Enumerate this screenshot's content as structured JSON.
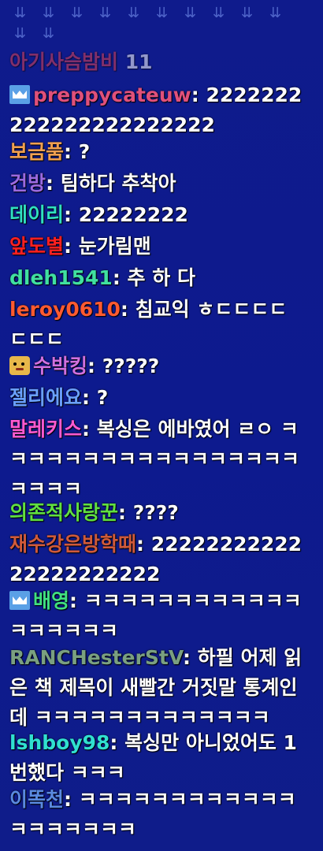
{
  "colors": {
    "background": "#0e1a8a",
    "text": "#ffffff"
  },
  "messages": [
    {
      "user": "아기사슴밤비",
      "text": "11",
      "color": "#e04050",
      "badge": "",
      "faded": true
    },
    {
      "user": "preppycateuw",
      "text": "2222222222222222222222",
      "color": "#e0507a",
      "badge": "crown-icon"
    },
    {
      "user": "보금품",
      "text": "?",
      "color": "#f0a050",
      "badge": ""
    },
    {
      "user": "건방",
      "text": "팀하다 추착아",
      "color": "#9b6ae0",
      "badge": ""
    },
    {
      "user": "데이리",
      "text": "22222222",
      "color": "#30e0c0",
      "badge": ""
    },
    {
      "user": "앞도별",
      "text": "눈가림맨",
      "color": "#ff2020",
      "badge": ""
    },
    {
      "user": "dleh1541",
      "text": "추 하 다",
      "color": "#40e0a0",
      "badge": ""
    },
    {
      "user": "leroy0610",
      "text": "침교익 ㅎㄷㄷㄷㄷ ㄷㄷㄷ",
      "color": "#ff5a30",
      "badge": ""
    },
    {
      "user": "수박킹",
      "text": "?????",
      "color": "#d070e0",
      "badge": "face-icon"
    },
    {
      "user": "젤리에요",
      "text": "?",
      "color": "#6aa0ff",
      "badge": ""
    },
    {
      "user": "말레키스",
      "text": "복싱은 에바였어 ㄹㅇ ㅋㅋㅋㅋㅋㅋㅋㅋㅋㅋㅋㅋㅋㅋㅋㅋㅋㅋㅋㅋㅋ",
      "color": "#ff5ad0",
      "badge": ""
    },
    {
      "user": "의존적사랑꾼",
      "text": "????",
      "color": "#60e040",
      "badge": ""
    },
    {
      "user": "재수강은방학때",
      "text": "2222222222222222222222",
      "color": "#d05a3a",
      "badge": ""
    },
    {
      "user": "배영",
      "text": "ㅋㅋㅋㅋㅋㅋㅋㅋㅋㅋㅋㅋㅋㅋㅋㅋㅋㅋ",
      "color": "#40e080",
      "badge": "crown-icon"
    },
    {
      "user": "RANCHesterStV",
      "text": "하필 어제 읽은 책 제목이 새빨간 거짓말 통계인데 ㅋㅋㅋㅋㅋㅋㅋㅋㅋㅋㅋㅋㅋ",
      "color": "#7aa080",
      "badge": ""
    },
    {
      "user": "lshboy98",
      "text": "복싱만 아니었어도 1번했다 ㅋㅋㅋ",
      "color": "#30e0d0",
      "badge": ""
    },
    {
      "user": "이똑천",
      "text": "ㅋㅋㅋㅋㅋㅋㅋㅋㅋㅋㅋㅋㅋㅋㅋㅋㅋㅋㅋ",
      "color": "#5a8ae0",
      "badge": ""
    }
  ]
}
